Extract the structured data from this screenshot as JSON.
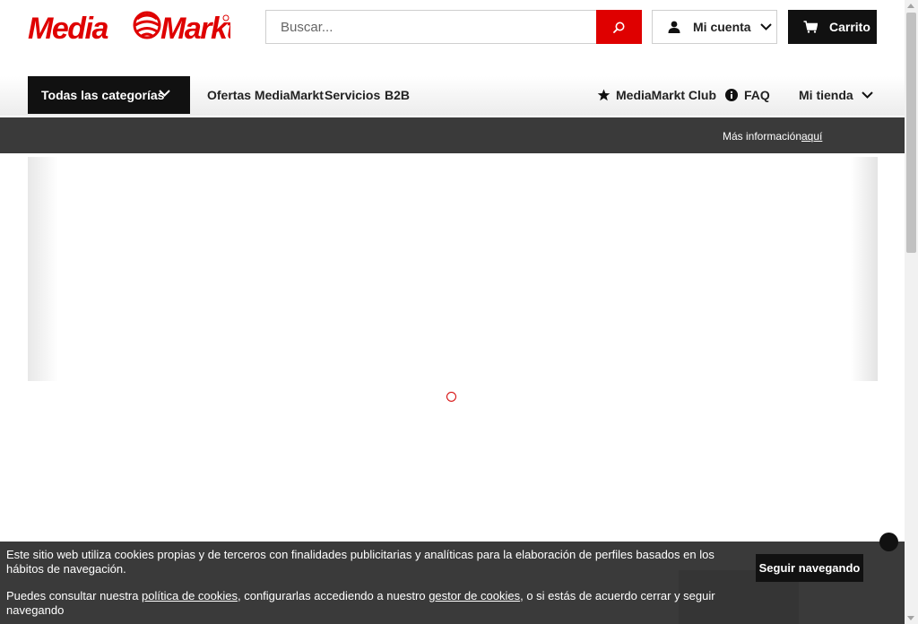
{
  "header": {
    "logo_text": "MediaMarkt",
    "search_placeholder": "Buscar...",
    "account_label": "Mi cuenta",
    "cart_label": "Carrito"
  },
  "nav": {
    "categories_label": "Todas las categorías",
    "links": [
      "Ofertas MediaMarkt",
      "Servicios",
      "B2B"
    ],
    "club_label": "MediaMarkt Club",
    "faq_label": "FAQ",
    "store_label": "Mi tienda"
  },
  "info_bar": {
    "text": "Más información",
    "link": "aquí"
  },
  "cookie_banner": {
    "line1": "Este sitio web utiliza cookies propias y de terceros con finalidades publicitarias y analíticas para la elaboración de perfiles basados en los hábitos de navegación.",
    "line2_pre": "Puedes consultar nuestra ",
    "policy_link": "política de cookies",
    "line2_mid": ", configurarlas accediendo a nuestro ",
    "manager_link": "gestor de cookies",
    "line2_post": ", o si estás de acuerdo cerrar y seguir navegando",
    "button": "Seguir navegando"
  },
  "colors": {
    "brand_red": "#df0000",
    "dark": "#111111",
    "bar_gray": "#3a3a3a"
  },
  "icons": [
    "search-icon",
    "user-icon",
    "chevron-down-icon",
    "cart-icon",
    "star-icon",
    "info-icon",
    "loading-spinner"
  ]
}
